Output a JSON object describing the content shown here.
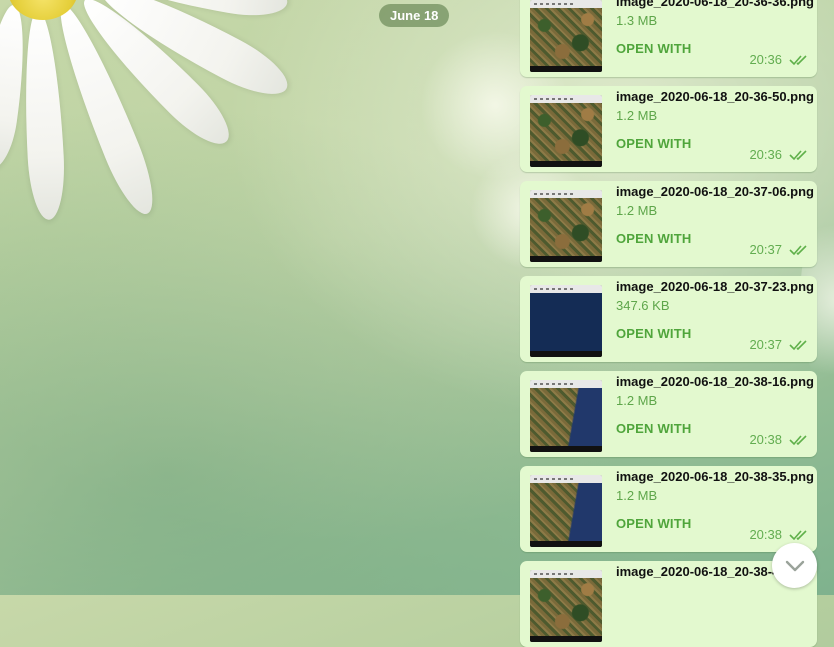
{
  "chat": {
    "date_separator": "June 18",
    "open_with_label": "OPEN WITH",
    "messages": [
      {
        "filename": "image_2020-06-18_20-36-36.png",
        "size": "1.3 MB",
        "time": "20:36",
        "thumb": "terrain"
      },
      {
        "filename": "image_2020-06-18_20-36-50.png",
        "size": "1.2 MB",
        "time": "20:36",
        "thumb": "terrain"
      },
      {
        "filename": "image_2020-06-18_20-37-06.png",
        "size": "1.2 MB",
        "time": "20:37",
        "thumb": "terrain"
      },
      {
        "filename": "image_2020-06-18_20-37-23.png",
        "size": "347.6 KB",
        "time": "20:37",
        "thumb": "water"
      },
      {
        "filename": "image_2020-06-18_20-38-16.png",
        "size": "1.2 MB",
        "time": "20:38",
        "thumb": "coast"
      },
      {
        "filename": "image_2020-06-18_20-38-35.png",
        "size": "1.2 MB",
        "time": "20:38",
        "thumb": "coast"
      },
      {
        "filename": "image_2020-06-18_20-38-44.png",
        "size": "",
        "time": "",
        "thumb": "terrain"
      }
    ]
  },
  "icons": {
    "read_status": "double-check-icon",
    "scroll_down": "chevron-down-icon"
  },
  "colors": {
    "bubble": "#e3f9cf",
    "accent": "#4fa53b",
    "date_pill": "#6e8c5a"
  }
}
